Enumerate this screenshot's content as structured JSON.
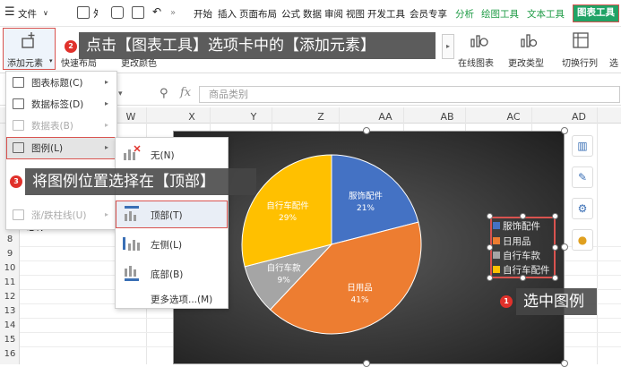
{
  "menubar": {
    "file": "文件",
    "tabs": [
      "开始",
      "插入",
      "页面布局",
      "公式",
      "数据",
      "审阅",
      "视图",
      "开发工具",
      "会员专享"
    ],
    "green_tabs": [
      "分析",
      "绘图工具",
      "文本工具"
    ],
    "active_tab": "图表工具"
  },
  "ribbon": {
    "add_element": "添加元素",
    "quick_layout": "快速布局",
    "change_color": "更改颜色",
    "online_chart": "在线图表",
    "change_type": "更改类型",
    "switch_row_col": "切换行列",
    "select": "选"
  },
  "formula_bar": {
    "fx": "fx",
    "placeholder": "商品类别"
  },
  "grid": {
    "columns": [
      "W",
      "X",
      "Y",
      "Z",
      "AA",
      "AB",
      "AC",
      "AD"
    ],
    "rows": [
      "7",
      "8",
      "9",
      "10",
      "11",
      "12",
      "13",
      "14",
      "15",
      "16"
    ],
    "partial_cell": "总计"
  },
  "add_element_menu": {
    "items": [
      {
        "label": "图表标题(C)",
        "enabled": true
      },
      {
        "label": "数据标签(D)",
        "enabled": true
      },
      {
        "label": "数据表(B)",
        "enabled": false
      },
      {
        "label": "图例(L)",
        "enabled": true
      },
      {
        "label": "涨/跌柱线(U)",
        "enabled": false
      }
    ],
    "hidden_letter": "B"
  },
  "legend_submenu": {
    "items": [
      "无(N)",
      "顶部(T)",
      "左侧(L)",
      "底部(B)"
    ],
    "more": "更多选项...(M)"
  },
  "chart_data": {
    "type": "pie",
    "slices": [
      {
        "label": "服饰配件",
        "value": 21,
        "color": "#4472c4"
      },
      {
        "label": "日用品",
        "value": 41,
        "color": "#ed7d31"
      },
      {
        "label": "自行车款",
        "value": 9,
        "color": "#a5a5a5"
      },
      {
        "label": "自行车配件",
        "value": 29,
        "color": "#ffc000"
      }
    ],
    "data_labels": [
      "服饰配件 21%",
      "日用品 41%",
      "自行车款 9%",
      "自行车配件 29%"
    ],
    "legend_placement": "right"
  },
  "callouts": {
    "step1": {
      "num": "1",
      "text": "选中图例"
    },
    "step2": {
      "num": "2",
      "text": "点击【图表工具】选项卡中的【添加元素】"
    },
    "step3": {
      "num": "3",
      "text": "将图例位置选择在【顶部】"
    }
  }
}
